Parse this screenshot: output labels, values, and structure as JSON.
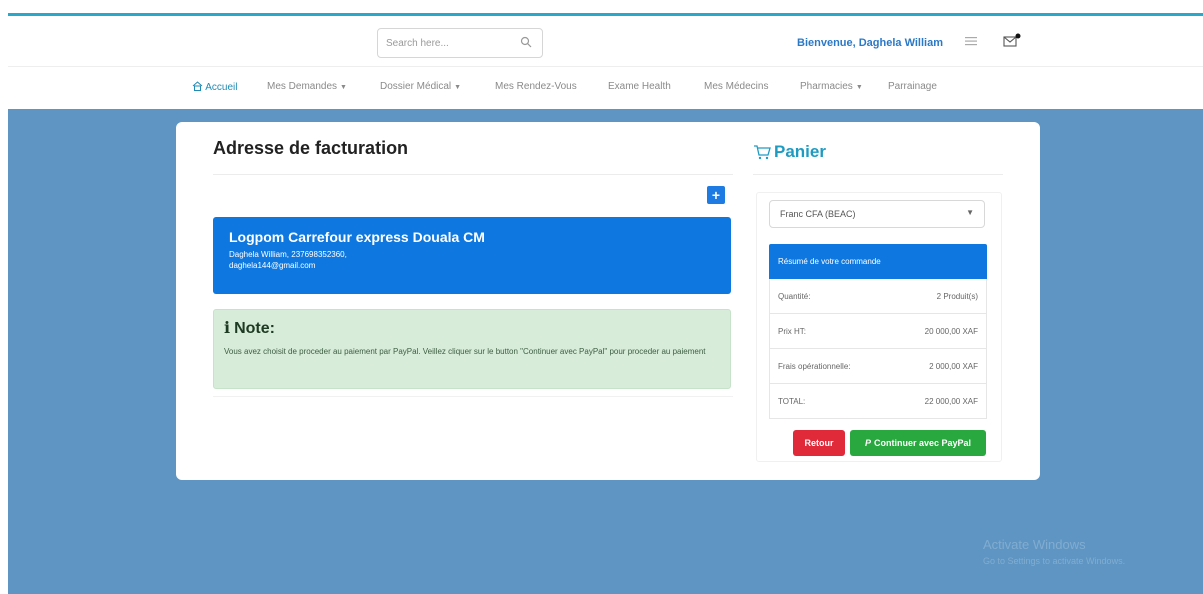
{
  "header": {
    "search_placeholder": "Search here...",
    "welcome": "Bienvenue, Daghela William"
  },
  "nav": {
    "items": [
      {
        "label": "Accueil"
      },
      {
        "label": "Mes Demandes"
      },
      {
        "label": "Dossier Médical"
      },
      {
        "label": "Mes Rendez-Vous"
      },
      {
        "label": "Exame Health"
      },
      {
        "label": "Mes Médecins"
      },
      {
        "label": "Pharmacies"
      },
      {
        "label": "Parrainage"
      }
    ]
  },
  "billing": {
    "title": "Adresse de facturation",
    "address": {
      "name": "Logpom Carrefour express Douala CM",
      "line1": "Daghela William, 237698352360,",
      "line2": "daghela144@gmail.com"
    },
    "note": {
      "title": "Note:",
      "text": "Vous avez choisit de proceder au paiement par PayPal. Veillez cliquer sur le button \"Continuer avec PayPal\" pour proceder au paiement"
    }
  },
  "cart": {
    "title": "Panier",
    "currency": "Franc CFA (BEAC)",
    "summary_title": "Résumé de votre commande",
    "rows": [
      {
        "label": "Quantité:",
        "value": "2 Produit(s)"
      },
      {
        "label": "Prix HT:",
        "value": "20 000,00 XAF"
      },
      {
        "label": "Frais opérationnelle:",
        "value": "2 000,00 XAF"
      },
      {
        "label": "TOTAL:",
        "value": "22 000,00 XAF"
      }
    ],
    "btn_back": "Retour",
    "btn_paypal": "Continuer avec PayPal"
  },
  "watermark": {
    "line1": "Activate Windows",
    "line2": "Go to Settings to activate Windows."
  },
  "colors": {
    "accent": "#1f8bb5",
    "primary": "#0f78e0",
    "background": "#5e95c3",
    "success": "#28a83e",
    "danger": "#e02a3a"
  }
}
